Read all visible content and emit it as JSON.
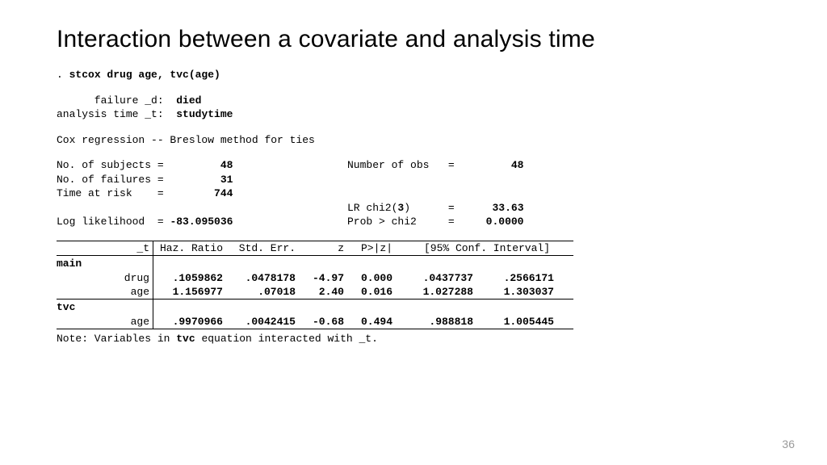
{
  "title": "Interaction between a covariate and analysis time",
  "command_prefix": ". ",
  "command": "stcox drug age, tvc(age)",
  "meta": {
    "failure_label": "      failure _d:  ",
    "failure_value": "died",
    "time_label": "analysis time _t:  ",
    "time_value": "studytime"
  },
  "method_line": "Cox regression -- Breslow method for ties",
  "stats_left": [
    {
      "label": "No. of subjects =",
      "value": "48"
    },
    {
      "label": "No. of failures =",
      "value": "31"
    },
    {
      "label": "Time at risk    =",
      "value": "744"
    },
    {
      "label": "",
      "value": ""
    },
    {
      "label": "Log likelihood  =",
      "value": "-83.095036"
    }
  ],
  "stats_right": [
    {
      "label": "Number of obs",
      "eq": "=",
      "value": "48"
    },
    {
      "label": "",
      "eq": "",
      "value": ""
    },
    {
      "label": "",
      "eq": "",
      "value": ""
    },
    {
      "label": "LR chi2(",
      "df": "3",
      "label2": ")",
      "eq": "=",
      "value": "33.63"
    },
    {
      "label": "Prob > chi2",
      "eq": "=",
      "value": "0.0000"
    }
  ],
  "table": {
    "header": {
      "t": "_t",
      "haz": "Haz. Ratio",
      "se": "Std. Err.",
      "z": "z",
      "pz": "P>|z|",
      "ci": "[95% Conf. Interval]"
    },
    "main_label": "main",
    "main": [
      {
        "name": "drug",
        "haz": ".1059862",
        "se": ".0478178",
        "z": "-4.97",
        "pz": "0.000",
        "cilo": ".0437737",
        "cihi": ".2566171"
      },
      {
        "name": "age",
        "haz": "1.156977",
        "se": ".07018",
        "z": "2.40",
        "pz": "0.016",
        "cilo": "1.027288",
        "cihi": "1.303037"
      }
    ],
    "tvc_label": "tvc",
    "tvc": [
      {
        "name": "age",
        "haz": ".9970966",
        "se": ".0042415",
        "z": "-0.68",
        "pz": "0.494",
        "cilo": ".988818",
        "cihi": "1.005445"
      }
    ]
  },
  "note_prefix": "Note: Variables in ",
  "note_bold": "tvc",
  "note_suffix": " equation interacted with _t.",
  "page": "36"
}
